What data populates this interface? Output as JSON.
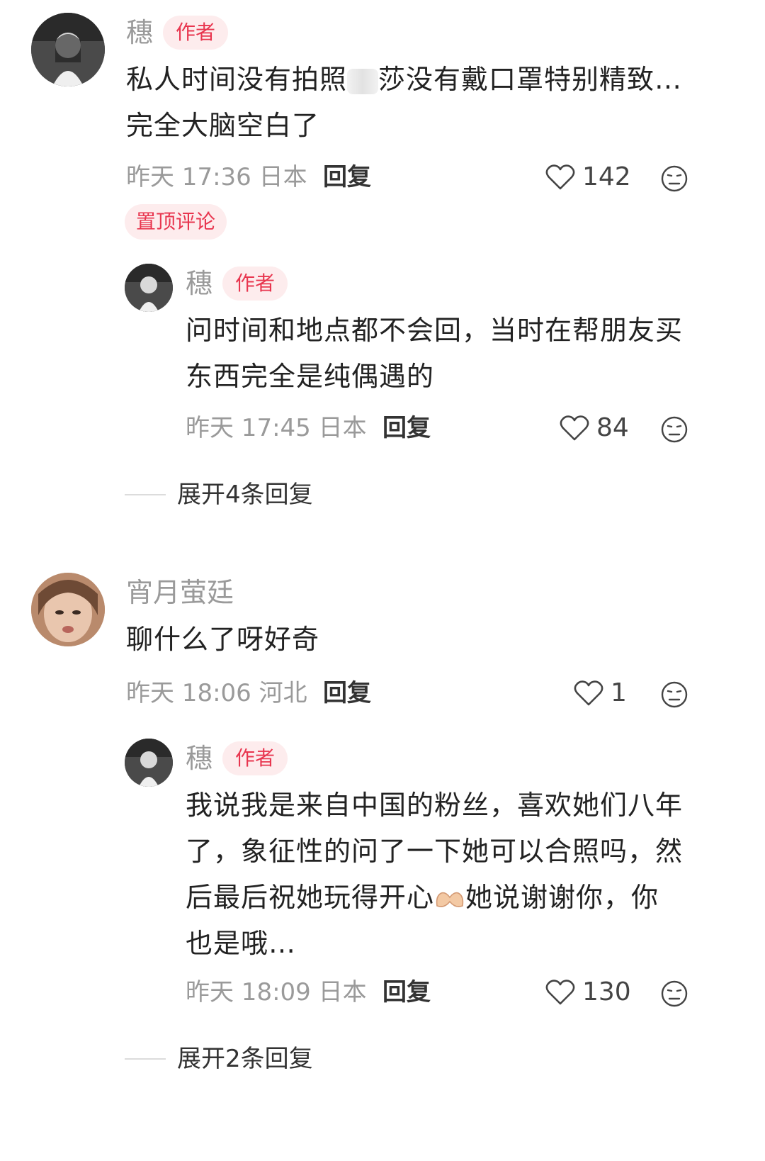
{
  "comments": [
    {
      "name": "穗",
      "tag": "作者",
      "text_line1": "私人时间没有拍照",
      "text_line1b": "莎没有戴口罩特别精致…",
      "text_line2": "完全大脑空白了",
      "time": "昨天 17:36 日本",
      "reply": "回复",
      "likes": "142",
      "pin": "置顶评论",
      "replies": [
        {
          "name": "穗",
          "tag": "作者",
          "line1": "问时间和地点都不会回，当时在帮朋友买",
          "line2": "东西完全是纯偶遇的",
          "time": "昨天 17:45 日本",
          "reply": "回复",
          "likes": "84"
        }
      ],
      "expand": "展开4条回复"
    },
    {
      "name": "宵月萤廷",
      "text": "聊什么了呀好奇",
      "time": "昨天 18:06 河北",
      "reply": "回复",
      "likes": "1",
      "replies": [
        {
          "name": "穗",
          "tag": "作者",
          "line1": "我说我是来自中国的粉丝，喜欢她们八年",
          "line2": "了，象征性的问了一下她可以合照吗，然",
          "line3a": "后最后祝她玩得开心",
          "line3b": "她说谢谢你，你",
          "line4": "也是哦…",
          "time": "昨天 18:09 日本",
          "reply": "回复",
          "likes": "130"
        }
      ],
      "expand": "展开2条回复"
    }
  ],
  "icons": {
    "like": "heart-outline-icon",
    "emoji": "neutral-face-icon",
    "inline_emoji": "heart-hands-emoji"
  },
  "colors": {
    "accent": "#e8364f",
    "tag_bg": "#fdeced",
    "muted": "#9a9a9a"
  }
}
